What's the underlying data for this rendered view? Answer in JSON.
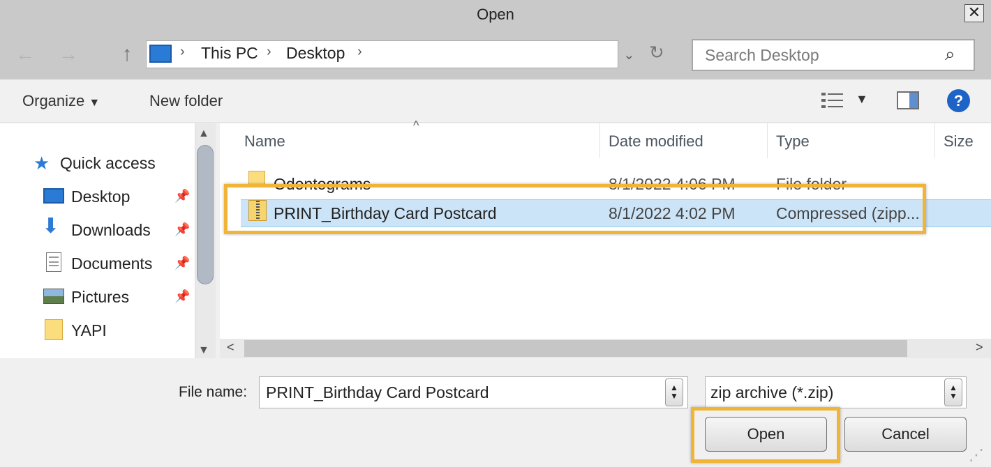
{
  "window": {
    "title": "Open",
    "close_glyph": "✕"
  },
  "nav": {
    "back_icon": "back-arrow-icon",
    "forward_icon": "forward-arrow-icon",
    "breadcrumbs": [
      "This PC",
      "Desktop"
    ],
    "search_placeholder": "Search Desktop"
  },
  "toolbar": {
    "organize": "Organize",
    "new_folder": "New folder",
    "help": "?"
  },
  "sidebar": {
    "items": [
      {
        "label": "Quick access",
        "icon": "star-icon",
        "pinned": false
      },
      {
        "label": "Desktop",
        "icon": "desktop-icon",
        "pinned": true
      },
      {
        "label": "Downloads",
        "icon": "download-icon",
        "pinned": true
      },
      {
        "label": "Documents",
        "icon": "document-icon",
        "pinned": true
      },
      {
        "label": "Pictures",
        "icon": "pictures-icon",
        "pinned": true
      },
      {
        "label": "YAPI",
        "icon": "folder-icon",
        "pinned": false
      }
    ]
  },
  "filelist": {
    "columns": [
      "Name",
      "Date modified",
      "Type",
      "Size"
    ],
    "rows": [
      {
        "name": "Odontograms",
        "date": "8/1/2022 4:06 PM",
        "type": "File folder",
        "icon": "folder-icon",
        "selected": false
      },
      {
        "name": "PRINT_Birthday Card Postcard",
        "date": "8/1/2022 4:02 PM",
        "type": "Compressed (zipp...",
        "icon": "zip-folder-icon",
        "selected": true
      }
    ]
  },
  "bottom": {
    "file_name_label": "File name:",
    "file_name_value": "PRINT_Birthday Card Postcard",
    "file_type_value": "zip archive (*.zip)",
    "open_label": "Open",
    "cancel_label": "Cancel"
  },
  "colors": {
    "accent_highlight": "#f0b537",
    "selection": "#cce4f7",
    "help_blue": "#1e63c6"
  }
}
